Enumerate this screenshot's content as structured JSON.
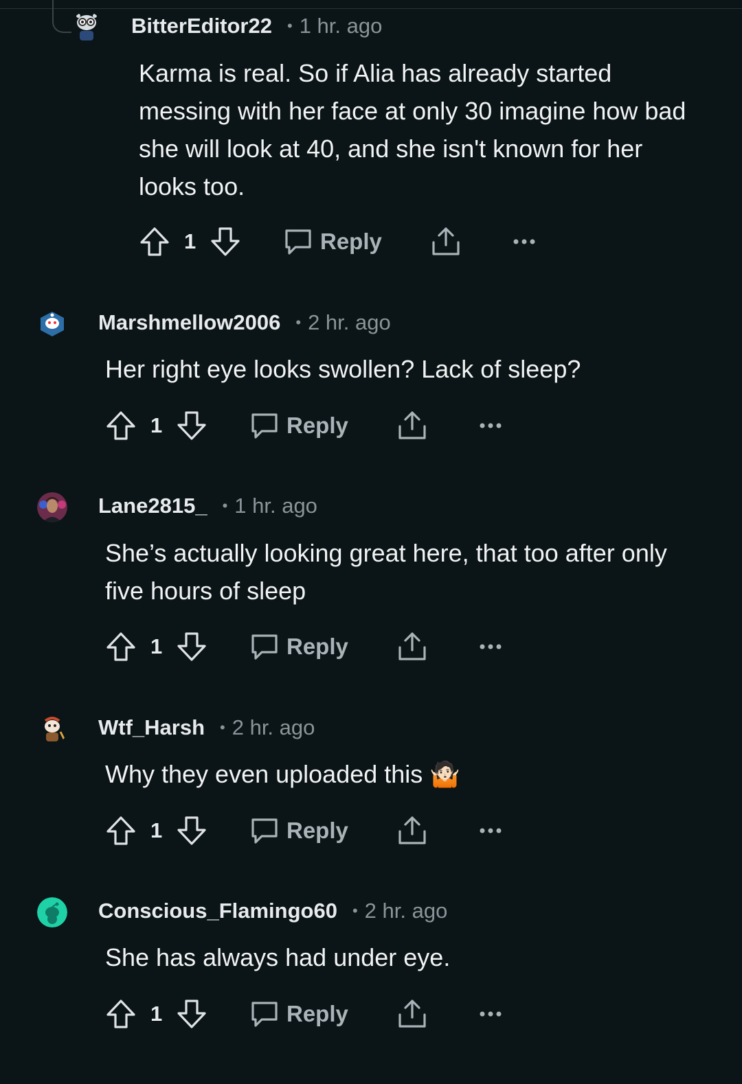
{
  "comments": [
    {
      "username": "BitterEditor22",
      "time": "1 hr. ago",
      "text": "Karma is real. So if Alia has already started messing with her face at only 30 imagine how bad she will look at 40, and she isn't known for her looks too.",
      "votes": "1",
      "reply_label": "Reply",
      "avatar_icon": "snoo-avatar-icon"
    },
    {
      "username": "Marshmellow2006",
      "time": "2 hr. ago",
      "text": "Her right eye looks swollen? Lack of sleep?",
      "votes": "1",
      "reply_label": "Reply",
      "avatar_icon": "snoo-avatar-icon"
    },
    {
      "username": "Lane2815_",
      "time": "1 hr. ago",
      "text": "She’s actually looking great here, that too after only five hours of sleep",
      "votes": "1",
      "reply_label": "Reply",
      "avatar_icon": "photo-avatar-icon"
    },
    {
      "username": "Wtf_Harsh",
      "time": "2 hr. ago",
      "text": "Why they even uploaded this 🤷🏻",
      "votes": "1",
      "reply_label": "Reply",
      "avatar_icon": "snoo-avatar-icon"
    },
    {
      "username": "Conscious_Flamingo60",
      "time": "2 hr. ago",
      "text": "She has always had under eye.",
      "votes": "1",
      "reply_label": "Reply",
      "avatar_icon": "default-snoo-avatar-icon"
    }
  ],
  "colors": {
    "background": "#0b1416",
    "username": "#e8ebed",
    "meta": "#8b9499",
    "action": "#aab3b8",
    "default_avatar": "#1fd1a7"
  }
}
